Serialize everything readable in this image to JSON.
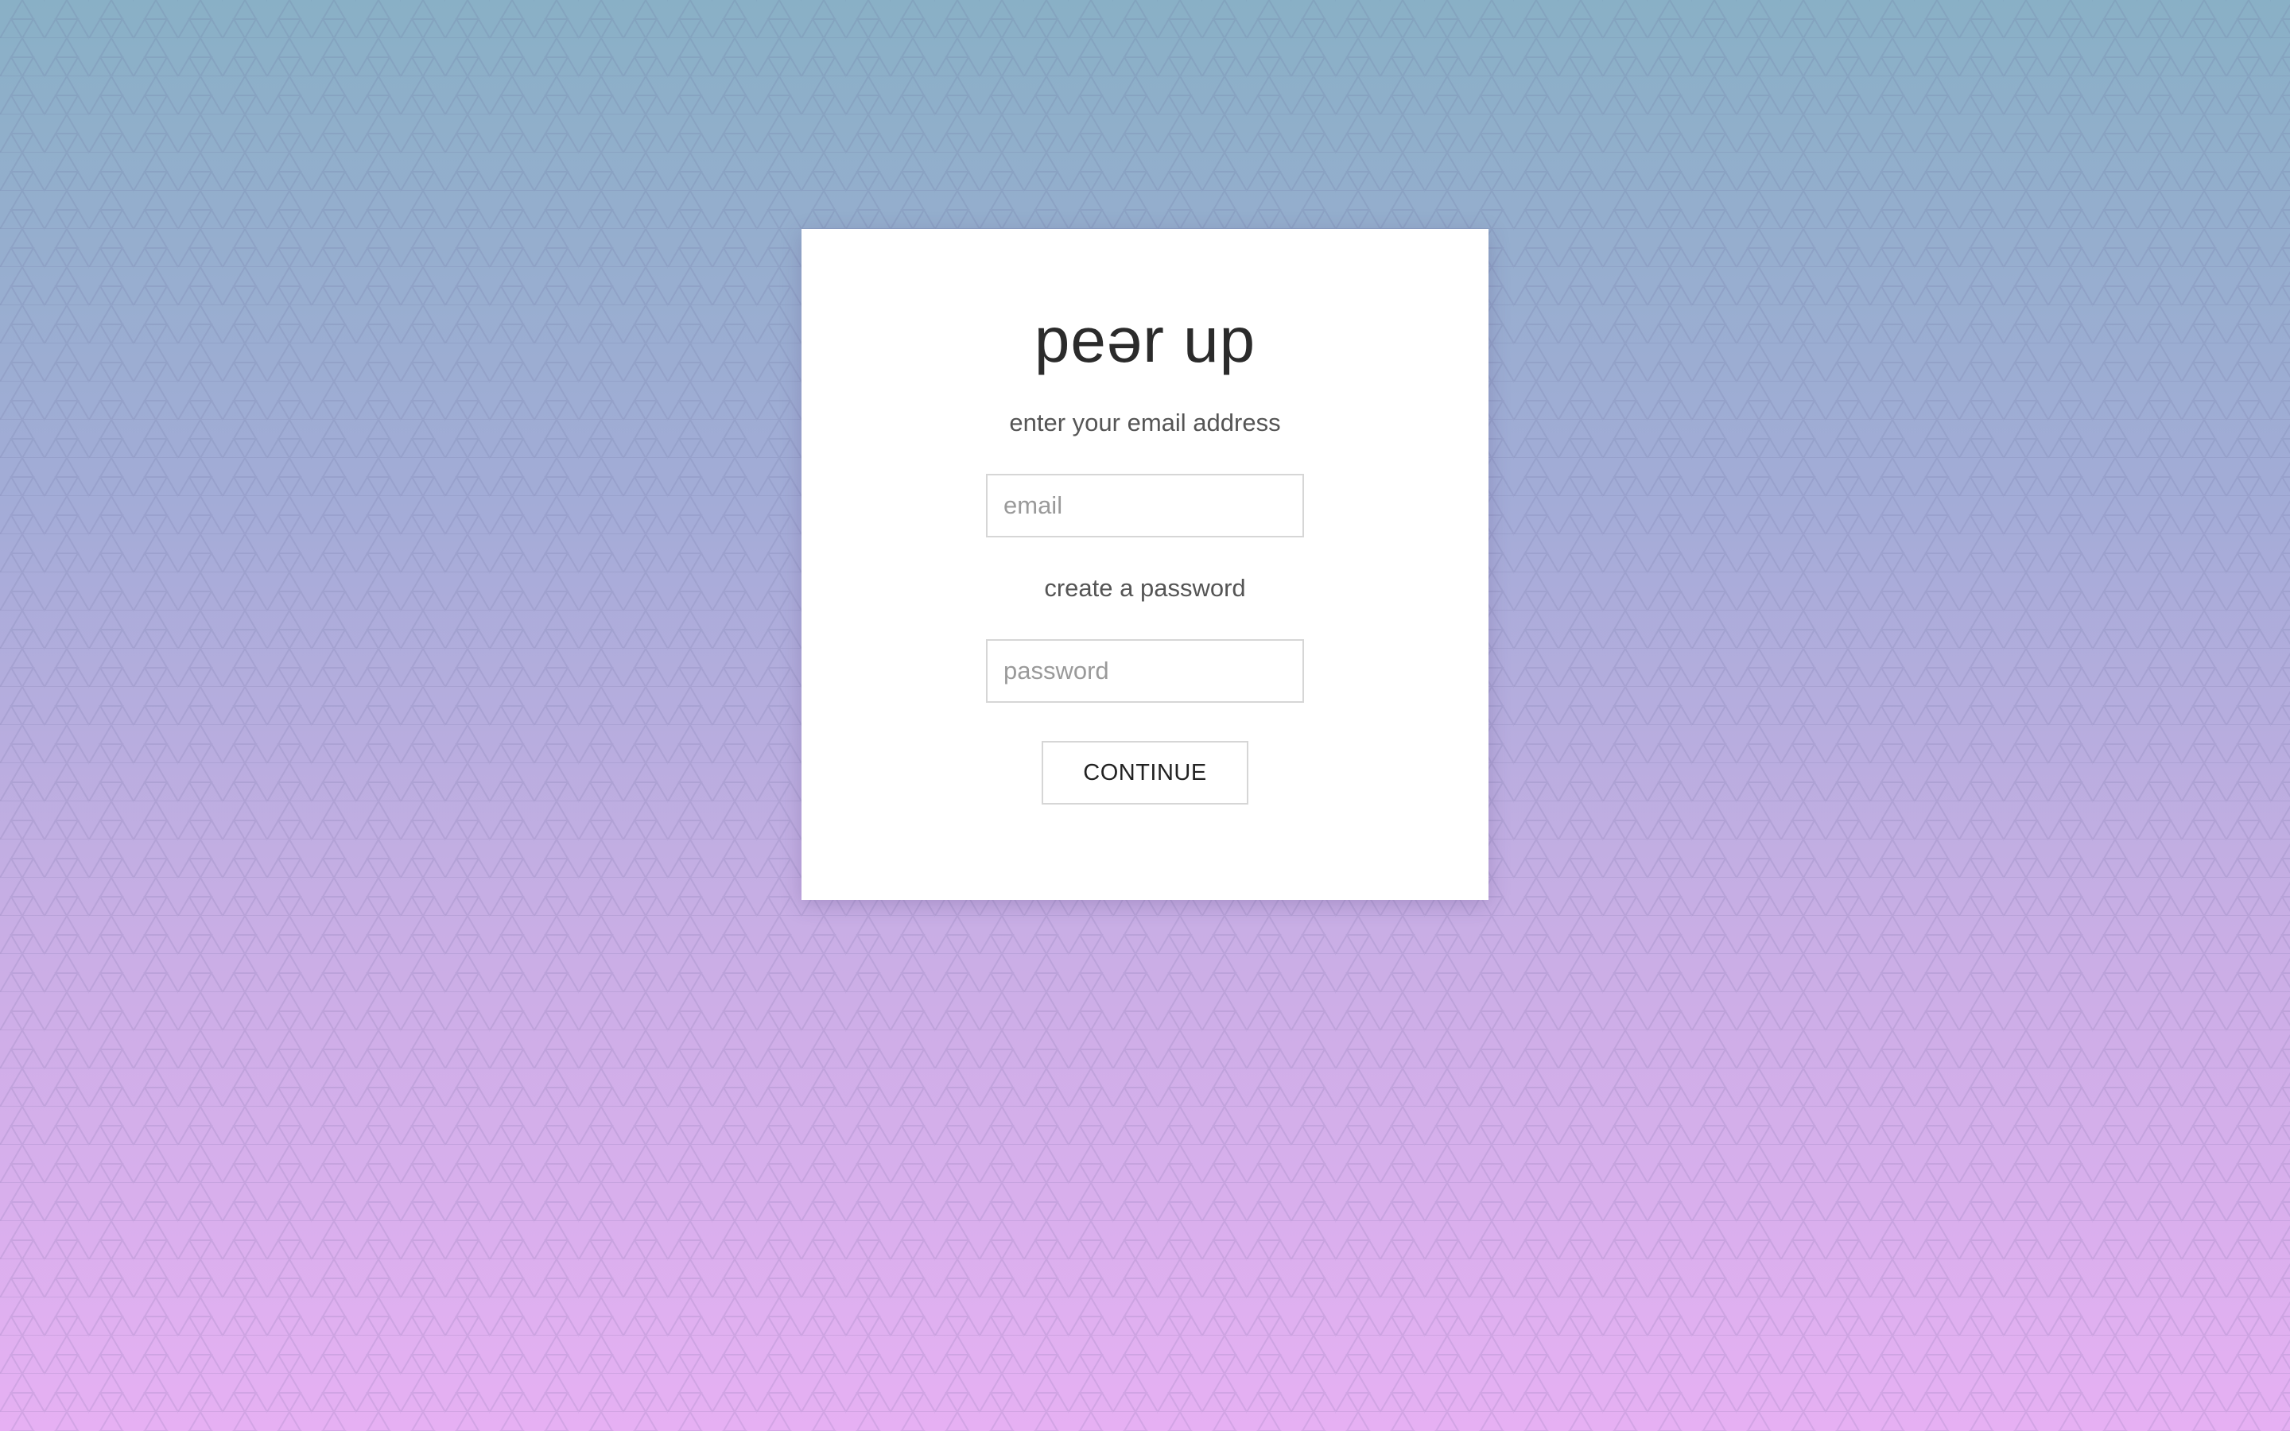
{
  "theme": {
    "gradient_top": "#89b0c6",
    "gradient_mid": "#a3acd7",
    "gradient_bottom": "#e6b0f3",
    "card_background": "#ffffff",
    "text_dark": "#2b2b2b",
    "text_muted": "#555555",
    "border": "#d6d6d6"
  },
  "background": {
    "pattern_icon": "triangle-lattice-pattern"
  },
  "signup": {
    "logo_text": "peər up",
    "email_prompt": "enter your email address",
    "email_placeholder": "email",
    "email_value": "",
    "password_prompt": "create a password",
    "password_placeholder": "password",
    "password_value": "",
    "continue_label": "CONTINUE"
  }
}
